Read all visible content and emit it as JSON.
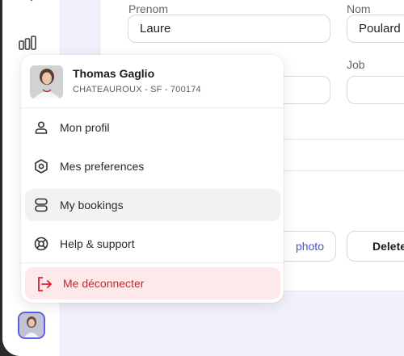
{
  "form": {
    "prenom_label": "Prenom",
    "prenom_value": "Laure",
    "nom_label": "Nom",
    "nom_value": "Poulard",
    "job_label": "Job",
    "photo_button": "photo",
    "delete_button": "Delete"
  },
  "user_menu": {
    "name": "Thomas Gaglio",
    "subtitle": "CHATEAUROUX - SF - 700174",
    "items": [
      {
        "label": "Mon profil",
        "icon": "user-icon"
      },
      {
        "label": "Mes preferences",
        "icon": "settings-hexagon-icon"
      },
      {
        "label": "My bookings",
        "icon": "database-icon"
      },
      {
        "label": "Help & support",
        "icon": "lifebuoy-icon"
      }
    ],
    "logout": {
      "label": "Me déconnecter",
      "icon": "logout-icon"
    }
  },
  "colors": {
    "accent": "#5b5fe0",
    "danger": "#d41f2c",
    "danger_bg": "#fde9ea",
    "page_bg": "#f1f1fb"
  }
}
